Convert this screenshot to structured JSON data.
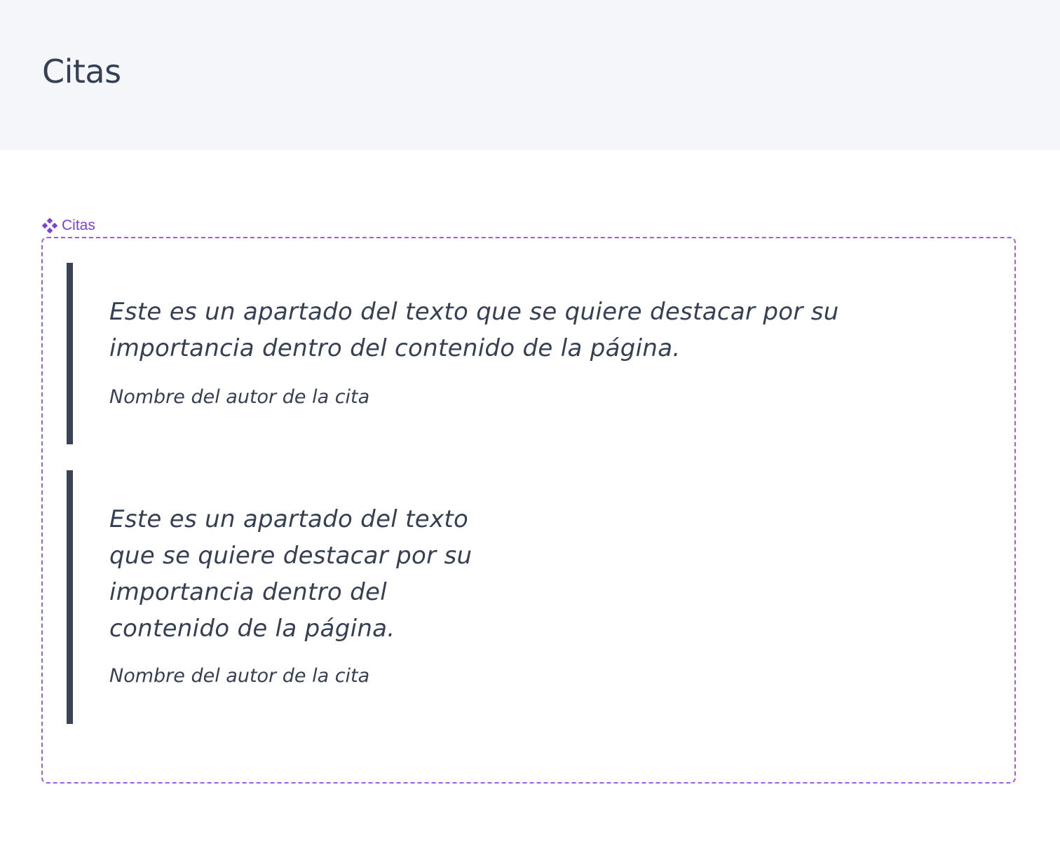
{
  "header": {
    "title": "Citas"
  },
  "component": {
    "tag_label": "Citas",
    "icon": "component-diamond-icon",
    "accent_color": "#7b3fe4"
  },
  "quotes": [
    {
      "text": "Este es un apartado del texto que se quiere destacar por su importancia dentro del contenido de la página.",
      "author": "Nombre del autor de la cita"
    },
    {
      "text": "Este es un apartado del texto que se quiere destacar por su importancia dentro del contenido de la página.",
      "author": "Nombre del autor de la cita"
    }
  ],
  "colors": {
    "header_bg": "#f4f6f9",
    "text": "#354055",
    "quote_bar": "#3b4356"
  }
}
